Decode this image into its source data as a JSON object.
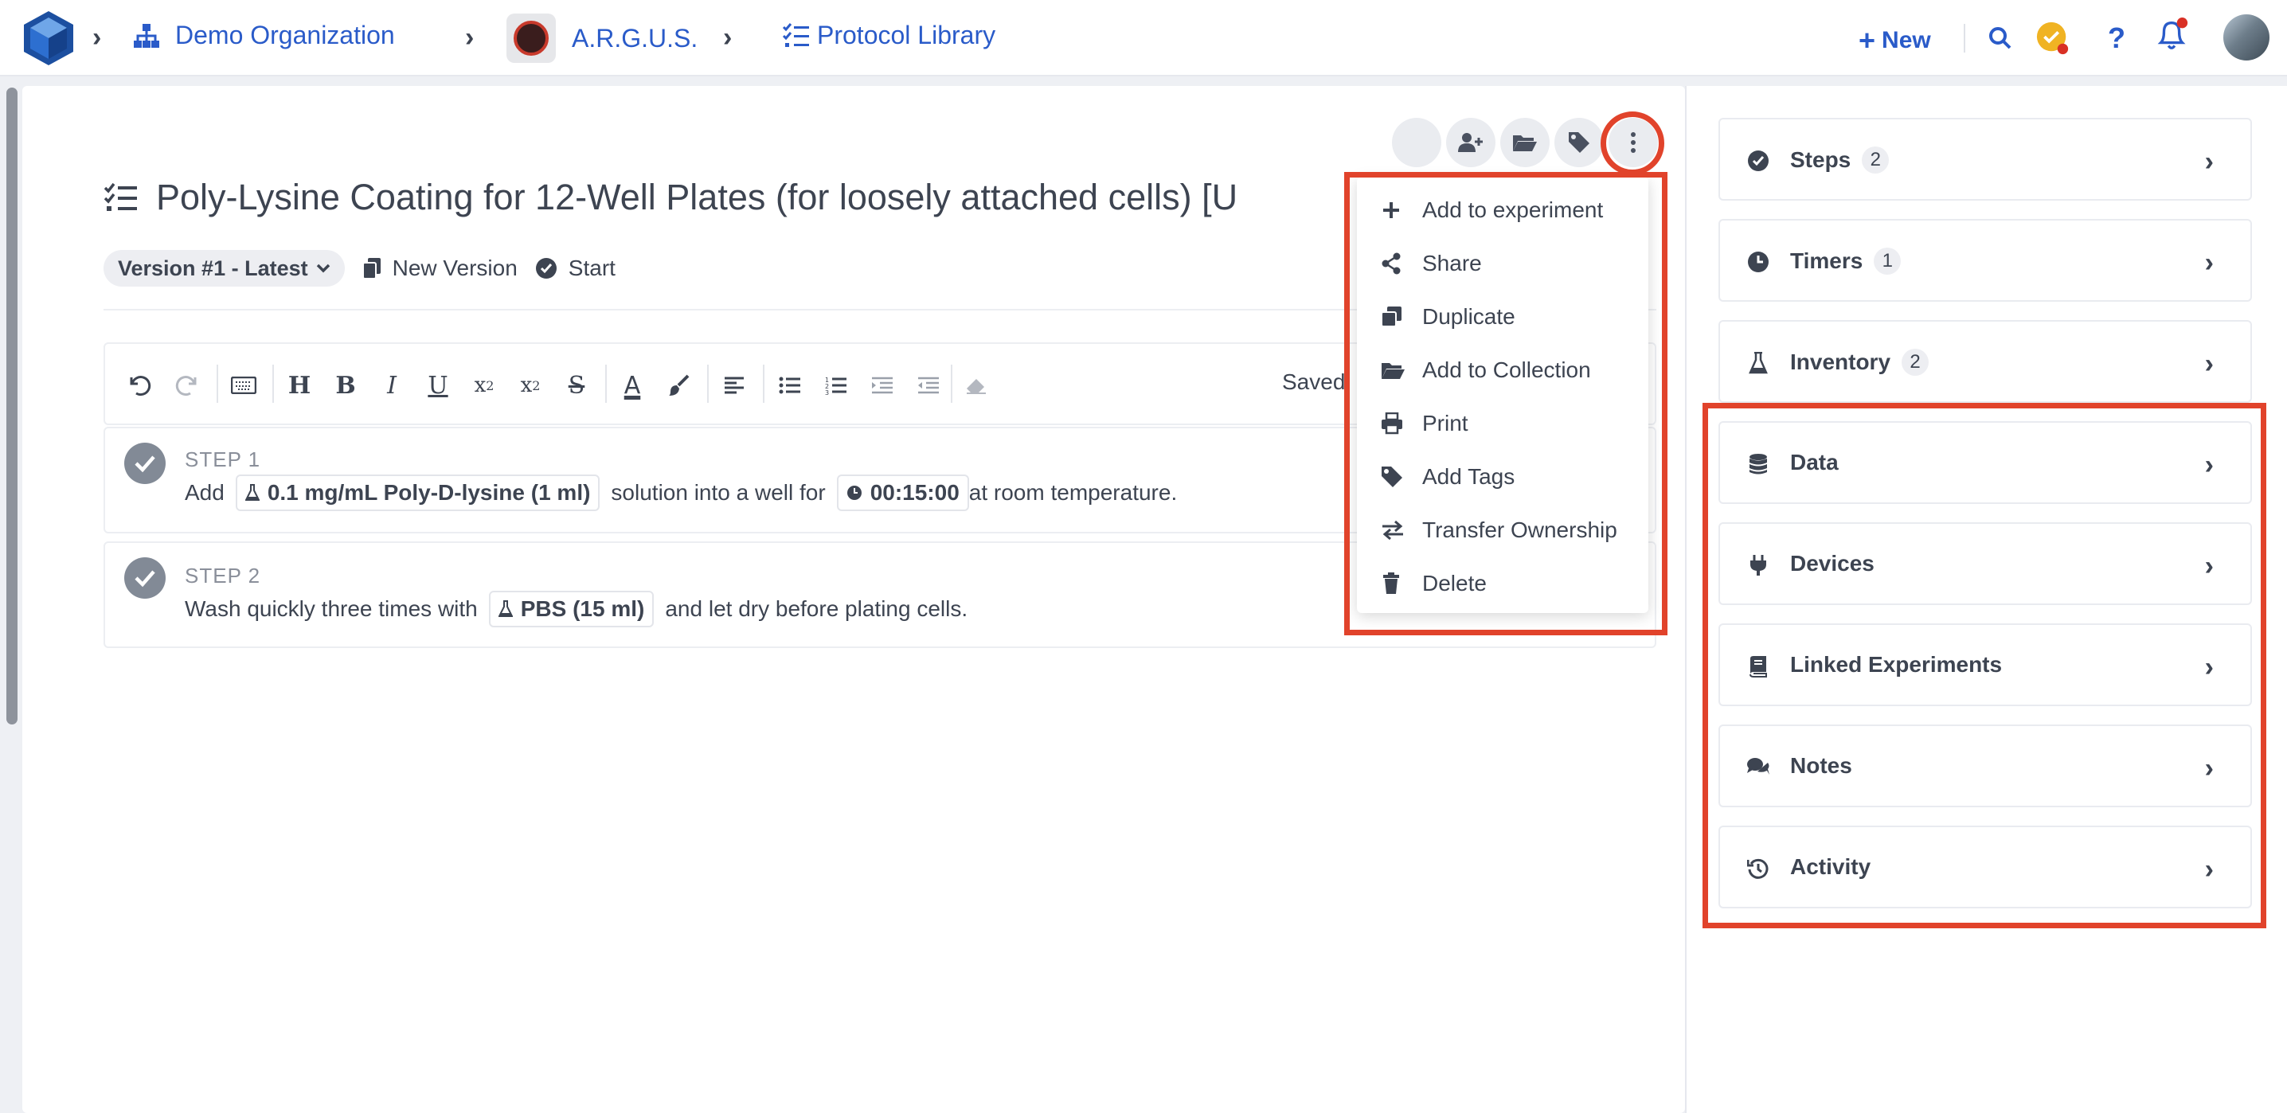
{
  "breadcrumb": {
    "org": "Demo Organization",
    "project": "A.R.G.U.S.",
    "library": "Protocol Library"
  },
  "topbar": {
    "new_label": "New"
  },
  "protocol": {
    "title": "Poly-Lysine Coating for 12-Well Plates (for loosely attached cells) [U",
    "version": "Version #1 - Latest",
    "new_version": "New Version",
    "start": "Start"
  },
  "editor": {
    "saved": "Saved"
  },
  "steps": [
    {
      "label": "STEP 1",
      "pre": "Add",
      "chip1": "0.1 mg/mL Poly-D-lysine (1 ml)",
      "mid": "solution into a well for",
      "chip2": "00:15:00",
      "post": "at room temperature."
    },
    {
      "label": "STEP 2",
      "pre": "Wash quickly three times with",
      "chip1": "PBS (15 ml)",
      "post": "and let dry before plating cells."
    }
  ],
  "menu": {
    "items": [
      {
        "label": "Add to experiment",
        "icon": "plus-icon"
      },
      {
        "label": "Share",
        "icon": "share-icon"
      },
      {
        "label": "Duplicate",
        "icon": "duplicate-icon"
      },
      {
        "label": "Add to Collection",
        "icon": "folder-icon"
      },
      {
        "label": "Print",
        "icon": "print-icon"
      },
      {
        "label": "Add Tags",
        "icon": "tag-icon"
      },
      {
        "label": "Transfer Ownership",
        "icon": "transfer-icon"
      },
      {
        "label": "Delete",
        "icon": "trash-icon"
      }
    ]
  },
  "sidebar": {
    "sections": [
      {
        "label": "Steps",
        "badge": "2",
        "icon": "check-circle-icon"
      },
      {
        "label": "Timers",
        "badge": "1",
        "icon": "clock-icon"
      },
      {
        "label": "Inventory",
        "badge": "2",
        "icon": "flask-icon"
      },
      {
        "label": "Data",
        "icon": "database-icon"
      },
      {
        "label": "Devices",
        "icon": "plug-icon"
      },
      {
        "label": "Linked Experiments",
        "icon": "book-icon"
      },
      {
        "label": "Notes",
        "icon": "comments-icon"
      },
      {
        "label": "Activity",
        "icon": "history-icon"
      }
    ]
  },
  "colors": {
    "link": "#2a5bc9",
    "highlight": "#e1432b",
    "text": "#3d4451"
  }
}
